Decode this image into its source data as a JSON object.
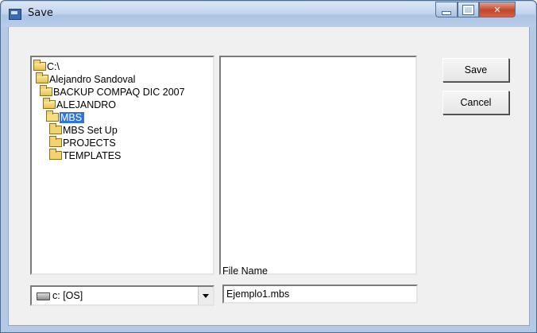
{
  "window": {
    "title": "Save"
  },
  "directory_tree": [
    {
      "label": "C:\\",
      "state": "open"
    },
    {
      "label": "Alejandro Sandoval",
      "state": "open"
    },
    {
      "label": "BACKUP COMPAQ DIC 2007",
      "state": "open"
    },
    {
      "label": "ALEJANDRO",
      "state": "open"
    },
    {
      "label": "MBS",
      "state": "open",
      "selected": true
    },
    {
      "label": "MBS Set Up",
      "state": "closed"
    },
    {
      "label": "PROJECTS",
      "state": "closed"
    },
    {
      "label": "TEMPLATES",
      "state": "closed"
    }
  ],
  "drive": {
    "selected": "c: [OS]",
    "icon": "drive-icon"
  },
  "file_name": {
    "label": "File Name",
    "value": "Ejemplo1.mbs"
  },
  "buttons": {
    "save_label": "Save",
    "cancel_label": "Cancel"
  },
  "colors": {
    "selection": "#3375d6",
    "dialog_bg": "#f0f0f0",
    "frame": "#b6c9e4",
    "close_button": "#c3462a"
  }
}
